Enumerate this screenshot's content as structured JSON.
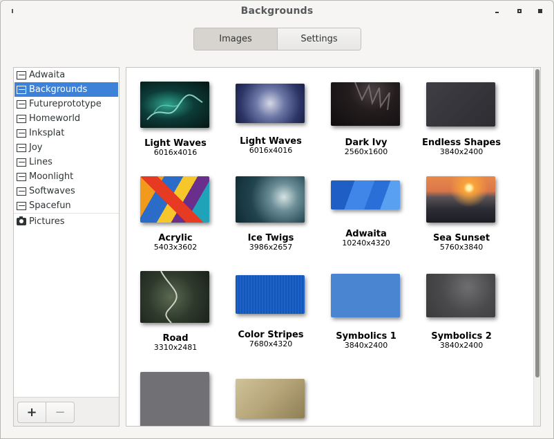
{
  "window": {
    "title": "Backgrounds"
  },
  "tabs": [
    {
      "label": "Images",
      "active": true
    },
    {
      "label": "Settings",
      "active": false
    }
  ],
  "sidebar": {
    "items": [
      {
        "label": "Adwaita",
        "selected": false
      },
      {
        "label": "Backgrounds",
        "selected": true
      },
      {
        "label": "Futureprototype",
        "selected": false
      },
      {
        "label": "Homeworld",
        "selected": false
      },
      {
        "label": "Inksplat",
        "selected": false
      },
      {
        "label": "Joy",
        "selected": false
      },
      {
        "label": "Lines",
        "selected": false
      },
      {
        "label": "Moonlight",
        "selected": false
      },
      {
        "label": "Softwaves",
        "selected": false
      },
      {
        "label": "Spacefun",
        "selected": false
      }
    ],
    "pictures": {
      "label": "Pictures"
    },
    "add_label": "+",
    "remove_label": "−"
  },
  "wallpapers": [
    {
      "name": "Light Waves",
      "size": "6016x4016"
    },
    {
      "name": "Light Waves",
      "size": "6016x4016"
    },
    {
      "name": "Dark Ivy",
      "size": "2560x1600"
    },
    {
      "name": "Endless Shapes",
      "size": "3840x2400"
    },
    {
      "name": "Acrylic",
      "size": "5403x3602"
    },
    {
      "name": "Ice Twigs",
      "size": "3986x2657"
    },
    {
      "name": "Adwaita",
      "size": "10240x4320"
    },
    {
      "name": "Sea Sunset",
      "size": "5760x3840"
    },
    {
      "name": "Road",
      "size": "3310x2481"
    },
    {
      "name": "Color Stripes",
      "size": "7680x4320"
    },
    {
      "name": "Symbolics 1",
      "size": "3840x2400"
    },
    {
      "name": "Symbolics 2",
      "size": "3840x2400"
    },
    {
      "name": "",
      "size": ""
    },
    {
      "name": "",
      "size": ""
    }
  ],
  "colors": {
    "selection": "#3d82d9",
    "scrollbar_thumb": "#8d8f8c"
  }
}
